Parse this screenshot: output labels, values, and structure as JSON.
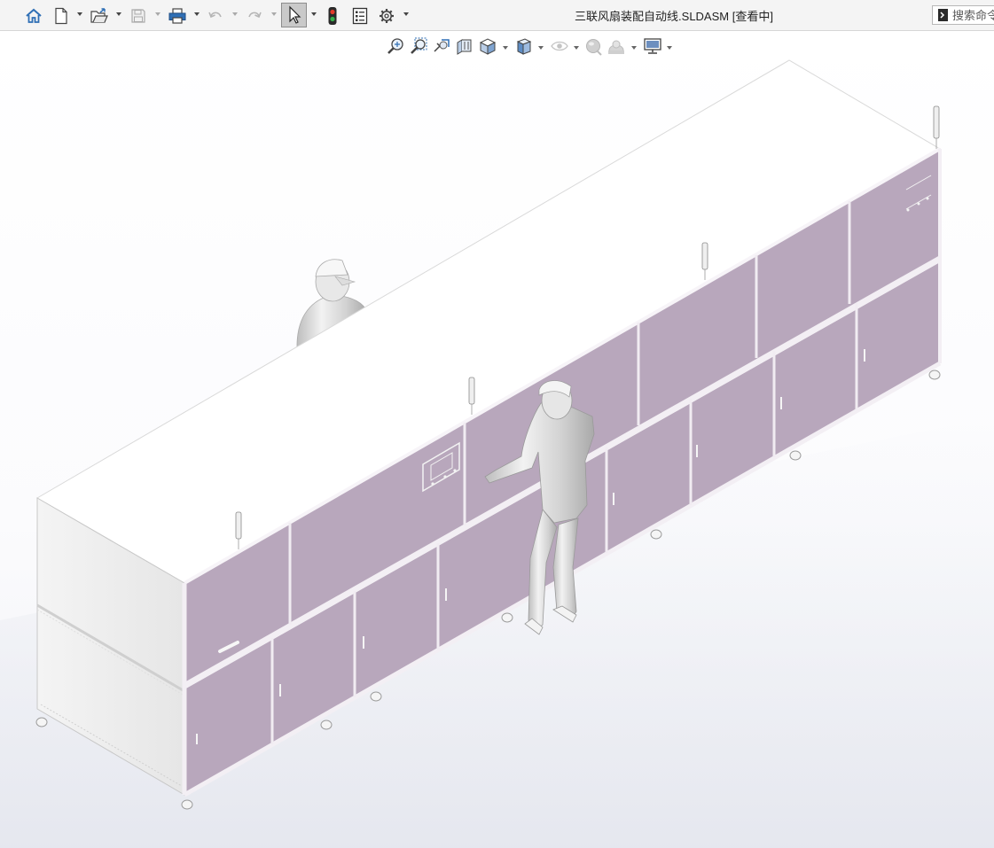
{
  "window": {
    "title": "三联风扇装配自动线.SLDASM [查看中]"
  },
  "toolbar": {
    "items": [
      {
        "name": "home-button",
        "icon": "home-icon"
      },
      {
        "name": "new-document-button",
        "icon": "new-document-icon"
      },
      {
        "name": "open-button",
        "icon": "open-folder-icon"
      },
      {
        "name": "save-button",
        "icon": "save-icon"
      },
      {
        "name": "print-button",
        "icon": "printer-icon"
      },
      {
        "name": "undo-button",
        "icon": "undo-icon"
      },
      {
        "name": "redo-button",
        "icon": "redo-icon"
      },
      {
        "name": "select-button",
        "icon": "cursor-arrow-icon"
      },
      {
        "name": "rebuild-button",
        "icon": "traffic-light-icon"
      },
      {
        "name": "file-properties-button",
        "icon": "file-properties-icon"
      },
      {
        "name": "options-button",
        "icon": "gear-icon"
      }
    ]
  },
  "search": {
    "placeholder": "搜索命令"
  },
  "heads_up_toolbar": {
    "items": [
      {
        "name": "zoom-to-fit-button",
        "icon": "zoom-fit-icon"
      },
      {
        "name": "zoom-to-area-button",
        "icon": "zoom-area-icon"
      },
      {
        "name": "previous-view-button",
        "icon": "previous-view-icon"
      },
      {
        "name": "section-view-button",
        "icon": "section-view-icon"
      },
      {
        "name": "view-orientation-button",
        "icon": "view-orientation-icon"
      },
      {
        "name": "display-style-button",
        "icon": "display-style-icon"
      },
      {
        "name": "hide-show-items-button",
        "icon": "eye-icon"
      },
      {
        "name": "edit-appearance-button",
        "icon": "appearance-sphere-icon"
      },
      {
        "name": "apply-scene-button",
        "icon": "scene-icon"
      },
      {
        "name": "view-settings-button",
        "icon": "monitor-icon"
      }
    ]
  },
  "colors": {
    "panel": "#b8a7bc",
    "panel_edge": "#ece6ee",
    "frame_white": "#ffffff",
    "toolbar_bg": "#f4f4f4",
    "icon_blue": "#2f6fb5"
  }
}
